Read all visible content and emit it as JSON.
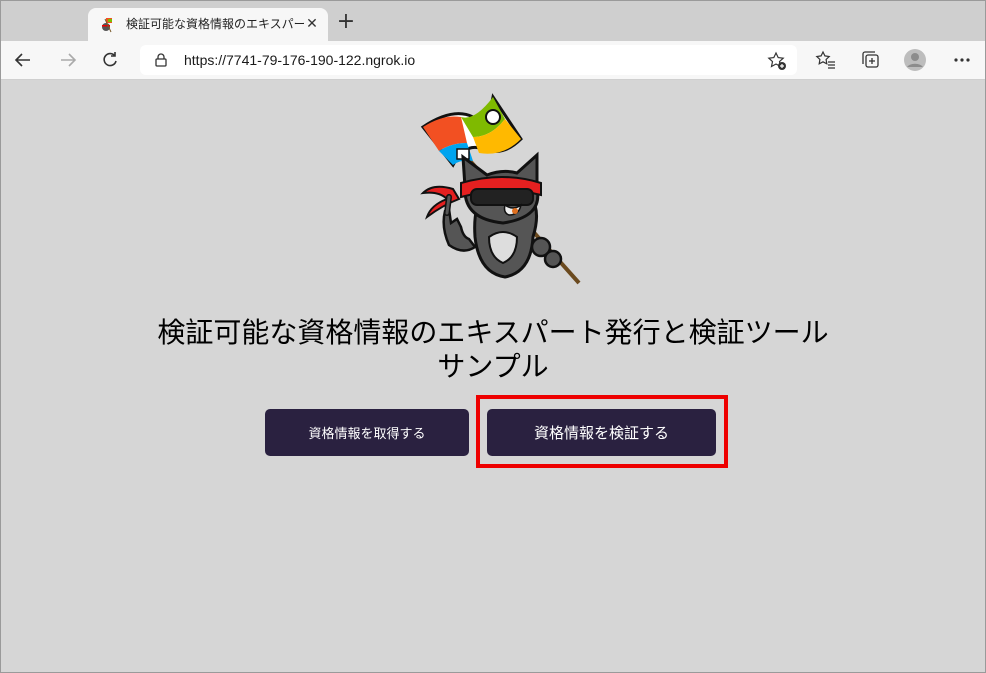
{
  "browser": {
    "tab_title": "検証可能な資格情報のエキスパートC",
    "tab_close": "✕",
    "new_tab": "+",
    "url": "https://7741-79-176-190-122.ngrok.io"
  },
  "page": {
    "title_line1": "検証可能な資格情報のエキスパート発行と検証ツール",
    "title_line2": "サンプル",
    "get_credential_button": "資格情報を取得する",
    "verify_credential_button": "資格情報を検証する"
  },
  "colors": {
    "button_bg": "#2a2140",
    "highlight": "#ee0000",
    "page_bg": "#d6d6d6"
  }
}
